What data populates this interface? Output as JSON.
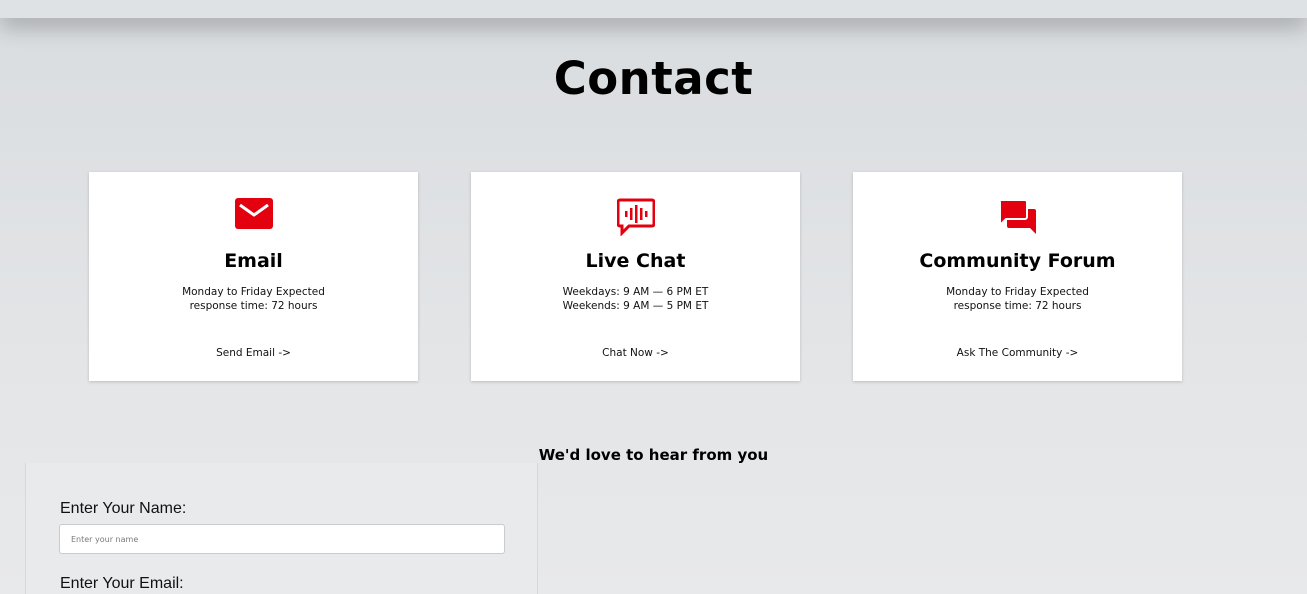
{
  "page": {
    "title": "Contact"
  },
  "cards": [
    {
      "icon": "envelope-icon",
      "title": "Email",
      "desc_lines": [
        "Monday to Friday Expected",
        "response time: 72 hours"
      ],
      "link": "Send Email ->"
    },
    {
      "icon": "live-chat-icon",
      "title": "Live Chat",
      "desc_lines": [
        "Weekdays: 9 AM — 6 PM ET",
        "Weekends: 9 AM — 5 PM ET"
      ],
      "link": "Chat Now ->"
    },
    {
      "icon": "forum-icon",
      "title": "Community Forum",
      "desc_lines": [
        "Monday to Friday Expected",
        "response time: 72 hours"
      ],
      "link": "Ask The Community ->"
    }
  ],
  "form": {
    "heading": "We'd love to hear from you",
    "name_label": "Enter Your Name:",
    "name_placeholder": "Enter your name",
    "email_label": "Enter Your Email:"
  },
  "colors": {
    "accent": "#e3000f",
    "card_bg": "#ffffff"
  }
}
